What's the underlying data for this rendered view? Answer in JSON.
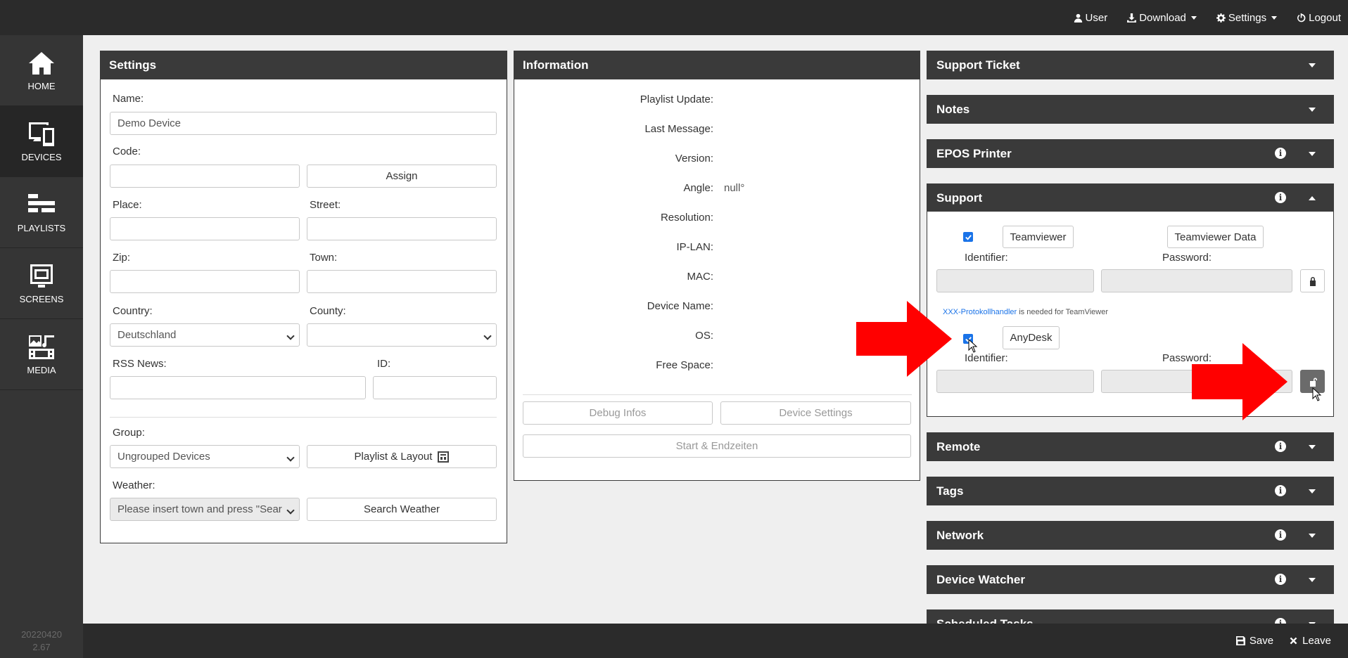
{
  "topnav": {
    "user": "User",
    "download": "Download",
    "settings": "Settings",
    "logout": "Logout"
  },
  "sidebar": {
    "items": [
      {
        "label": "HOME",
        "icon": "home-icon"
      },
      {
        "label": "DEVICES",
        "icon": "devices-icon"
      },
      {
        "label": "PLAYLISTS",
        "icon": "playlists-icon"
      },
      {
        "label": "SCREENS",
        "icon": "screens-icon"
      },
      {
        "label": "MEDIA",
        "icon": "media-icon"
      }
    ],
    "version_line1": "20220420",
    "version_line2": "2.67"
  },
  "settings_panel": {
    "title": "Settings",
    "name_label": "Name:",
    "name_value": "Demo Device",
    "code_label": "Code:",
    "assign_label": "Assign",
    "place_label": "Place:",
    "street_label": "Street:",
    "zip_label": "Zip:",
    "town_label": "Town:",
    "country_label": "Country:",
    "country_value": "Deutschland",
    "county_label": "County:",
    "rss_label": "RSS News:",
    "id_label": "ID:",
    "group_label": "Group:",
    "group_value": "Ungrouped Devices",
    "playlist_layout_label": "Playlist & Layout",
    "weather_label": "Weather:",
    "weather_value": "Please insert town and press \"Sear",
    "search_weather_label": "Search Weather"
  },
  "info_panel": {
    "title": "Information",
    "rows": [
      {
        "key": "Playlist Update:",
        "value": ""
      },
      {
        "key": "Last Message:",
        "value": ""
      },
      {
        "key": "Version:",
        "value": ""
      },
      {
        "key": "Angle:",
        "value": "null°"
      },
      {
        "key": "Resolution:",
        "value": ""
      },
      {
        "key": "IP-LAN:",
        "value": ""
      },
      {
        "key": "MAC:",
        "value": ""
      },
      {
        "key": "Device Name:",
        "value": ""
      },
      {
        "key": "OS:",
        "value": ""
      },
      {
        "key": "Free Space:",
        "value": ""
      }
    ],
    "debug_label": "Debug Infos",
    "device_settings_label": "Device Settings",
    "start_end_label": "Start & Endzeiten"
  },
  "right": {
    "support_ticket": "Support Ticket",
    "notes": "Notes",
    "epos_printer": "EPOS Printer",
    "support": "Support",
    "remote": "Remote",
    "tags": "Tags",
    "network": "Network",
    "device_watcher": "Device Watcher",
    "scheduled_tasks": "Scheduled Tasks"
  },
  "support": {
    "teamviewer_label": "Teamviewer",
    "teamviewer_data_label": "Teamviewer Data",
    "identifier_label": "Identifier:",
    "password_label": "Password:",
    "protocol_link": "XXX-Protokollhandler",
    "protocol_note": " is needed for TeamViewer",
    "anydesk_label": "AnyDesk"
  },
  "footer": {
    "save": "Save",
    "leave": "Leave"
  },
  "colors": {
    "dark": "#2b2b2b",
    "panel_header": "#3a3a3a",
    "accent_link": "#1a73e8",
    "arrow": "#ff0000"
  }
}
